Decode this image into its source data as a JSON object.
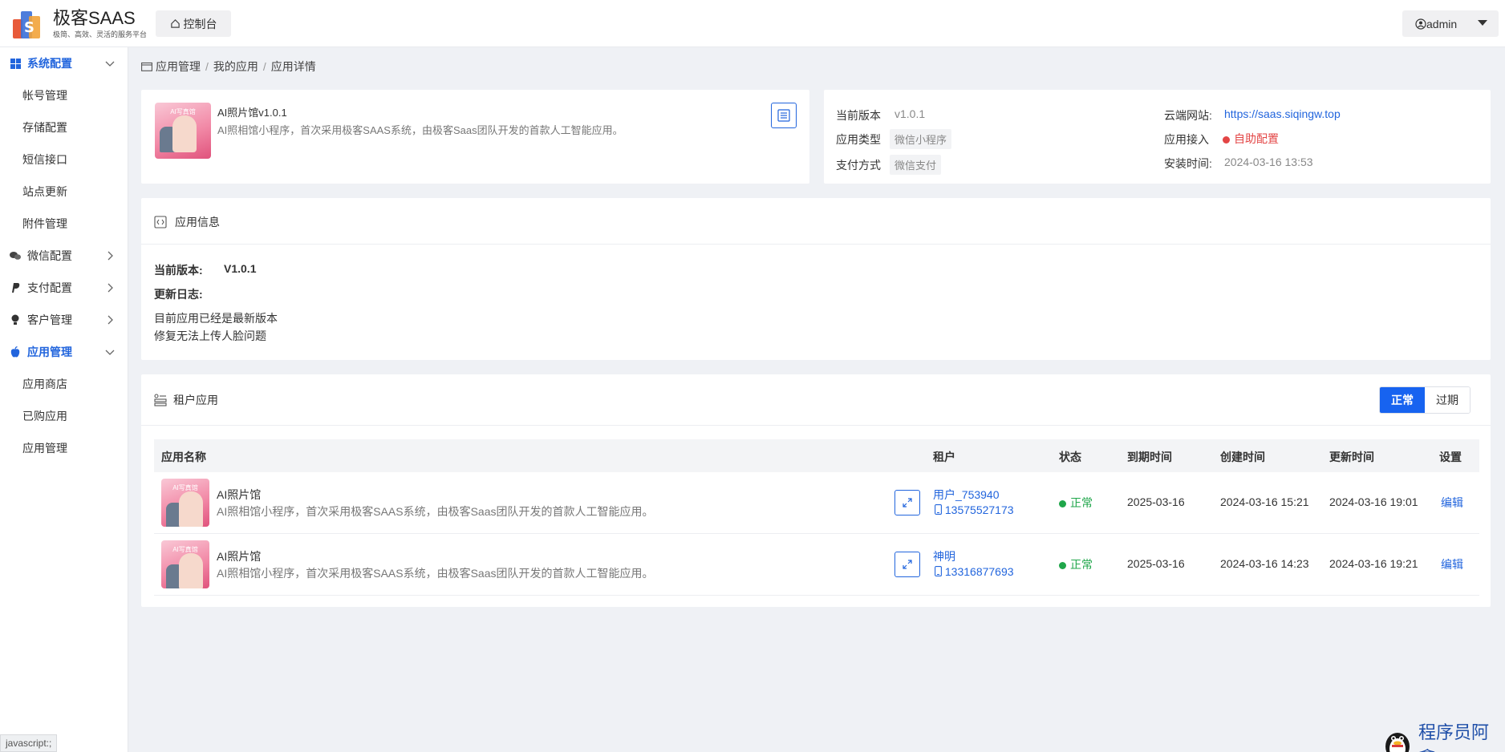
{
  "header": {
    "logo_title": "极客SAAS",
    "logo_sub": "极简、高效、灵活的服务平台",
    "console_label": "控制台",
    "user_label": "admin"
  },
  "sidebar": {
    "groups": [
      {
        "label": "系统配置",
        "icon": "grid-icon",
        "expanded": true,
        "active": true,
        "items": [
          "帐号管理",
          "存储配置",
          "短信接口",
          "站点更新",
          "附件管理"
        ]
      },
      {
        "label": "微信配置",
        "icon": "wechat-icon",
        "expanded": false
      },
      {
        "label": "支付配置",
        "icon": "paypal-icon",
        "expanded": false
      },
      {
        "label": "客户管理",
        "icon": "user-icon",
        "expanded": false
      },
      {
        "label": "应用管理",
        "icon": "apple-icon",
        "expanded": true,
        "active": true,
        "items": [
          "应用商店",
          "已购应用",
          "应用管理"
        ]
      }
    ]
  },
  "breadcrumb": [
    "应用管理",
    "我的应用",
    "应用详情"
  ],
  "app_card": {
    "name": "AI照片馆v1.0.1",
    "description": "AI照相馆小程序，首次采用极客SAAS系统，由极客Saas团队开发的首款人工智能应用。",
    "thumb_text": "AI写真馆"
  },
  "meta": {
    "version_label": "当前版本",
    "version_value": "v1.0.1",
    "type_label": "应用类型",
    "type_value": "微信小程序",
    "pay_label": "支付方式",
    "pay_value": "微信支付",
    "site_label": "云端网站:",
    "site_value": "https://saas.siqingw.top",
    "access_label": "应用接入",
    "access_value": "自助配置",
    "install_label": "安装时间:",
    "install_value": "2024-03-16 13:53"
  },
  "app_info": {
    "title": "应用信息",
    "version_label": "当前版本:",
    "version_value": "V1.0.1",
    "log_label": "更新日志:",
    "log_lines": [
      "目前应用已经是最新版本",
      "修复无法上传人脸问题"
    ]
  },
  "tenant": {
    "title": "租户应用",
    "filter_on": "正常",
    "filter_off": "过期",
    "columns": [
      "应用名称",
      "租户",
      "状态",
      "到期时间",
      "创建时间",
      "更新时间",
      "设置"
    ],
    "rows": [
      {
        "name": "AI照片馆",
        "desc": "AI照相馆小程序，首次采用极客SAAS系统，由极客Saas团队开发的首款人工智能应用。",
        "user": "用户_753940",
        "phone": "13575527173",
        "status": "正常",
        "expire": "2025-03-16",
        "created": "2024-03-16 15:21",
        "updated": "2024-03-16 19:01",
        "action": "编辑"
      },
      {
        "name": "AI照片馆",
        "desc": "AI照相馆小程序，首次采用极客SAAS系统，由极客Saas团队开发的首款人工智能应用。",
        "user": "神明",
        "phone": "13316877693",
        "status": "正常",
        "expire": "2025-03-16",
        "created": "2024-03-16 14:23",
        "updated": "2024-03-16 19:21",
        "action": "编辑"
      }
    ]
  },
  "statusbar": "javascript:;",
  "watermark": "程序员阿鑫",
  "colors": {
    "accent": "#2265dd",
    "ok": "#1fa64a",
    "danger": "#e34545"
  }
}
